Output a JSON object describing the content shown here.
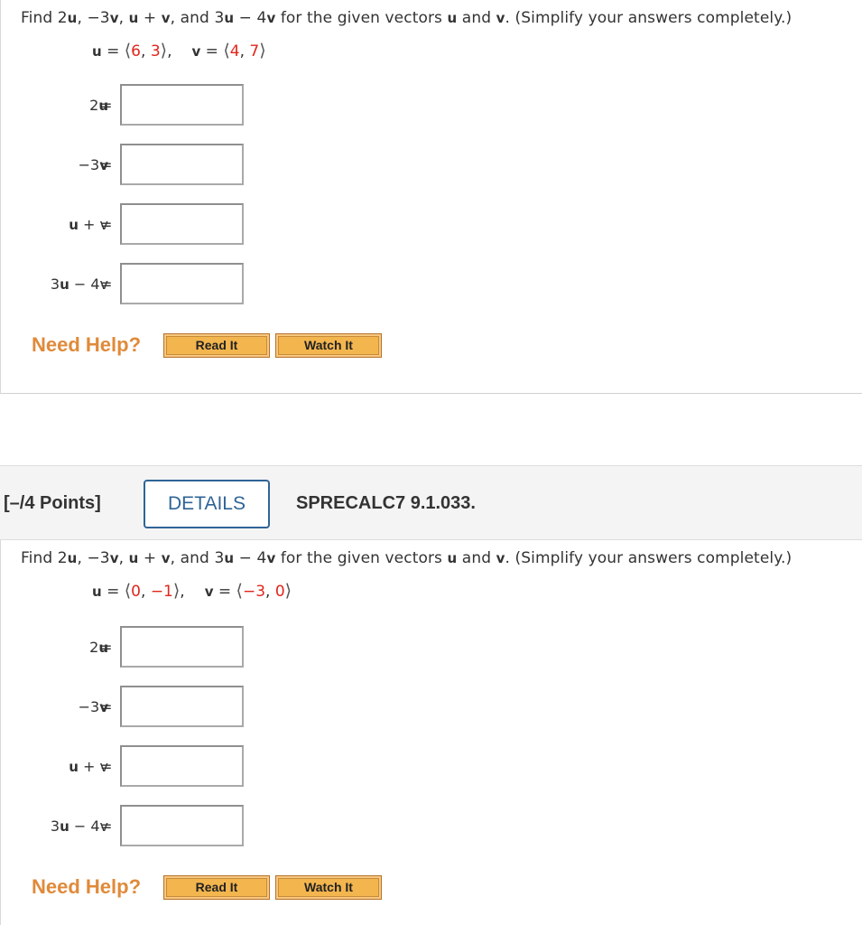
{
  "questions": [
    {
      "prompt": {
        "p1": "Find 2",
        "u1": "u",
        "p2": ", −3",
        "v1": "v",
        "p3": ", ",
        "u2": "u",
        "p4": " + ",
        "v2": "v",
        "p5": ", and 3",
        "u3": "u",
        "p6": " − 4",
        "v3": "v",
        "p7": " for the given vectors ",
        "u4": "u",
        "p8": " and ",
        "v4": "v",
        "p9": ". (Simplify your answers completely.)"
      },
      "vectors": {
        "u_name": "u",
        "u_components": [
          "6",
          "3"
        ],
        "v_name": "v",
        "v_components": [
          "4",
          "7"
        ]
      },
      "answers": [
        {
          "label_pre": "2",
          "label_bold": "u",
          "label_post": "",
          "value": ""
        },
        {
          "label_pre": "−3",
          "label_bold": "v",
          "label_post": "",
          "value": ""
        },
        {
          "label_pre": "",
          "label_bold": "u",
          "label_post": " + v",
          "value": ""
        },
        {
          "label_pre": "3",
          "label_bold": "u",
          "label_post": " − 4v",
          "value": ""
        }
      ],
      "help": {
        "label": "Need Help?",
        "read_it": "Read It",
        "watch_it": "Watch It"
      }
    },
    {
      "header": {
        "points": "[–/4 Points]",
        "details": "DETAILS",
        "problem_id": "SPRECALC7 9.1.033."
      },
      "prompt": {
        "p1": "Find 2",
        "u1": "u",
        "p2": ", −3",
        "v1": "v",
        "p3": ", ",
        "u2": "u",
        "p4": " + ",
        "v2": "v",
        "p5": ", and 3",
        "u3": "u",
        "p6": " − 4",
        "v3": "v",
        "p7": " for the given vectors ",
        "u4": "u",
        "p8": " and ",
        "v4": "v",
        "p9": ". (Simplify your answers completely.)"
      },
      "vectors": {
        "u_name": "u",
        "u_components": [
          "0",
          "−1"
        ],
        "v_name": "v",
        "v_components": [
          "−3",
          "0"
        ]
      },
      "answers": [
        {
          "label_pre": "2",
          "label_bold": "u",
          "label_post": "",
          "value": ""
        },
        {
          "label_pre": "−3",
          "label_bold": "v",
          "label_post": "",
          "value": ""
        },
        {
          "label_pre": "",
          "label_bold": "u",
          "label_post": " + v",
          "value": ""
        },
        {
          "label_pre": "3",
          "label_bold": "u",
          "label_post": " − 4v",
          "value": ""
        }
      ],
      "help": {
        "label": "Need Help?",
        "read_it": "Read It",
        "watch_it": "Watch It"
      }
    }
  ],
  "symbols": {
    "equals": "=",
    "lang": "⟨",
    "rang": "⟩",
    "comma": ", ",
    "trail_comma": ","
  },
  "colors": {
    "given_value": "#e0261c",
    "details_blue": "#2f6496",
    "help_orange": "#e08a3a",
    "button_fill": "#f3b54e"
  }
}
